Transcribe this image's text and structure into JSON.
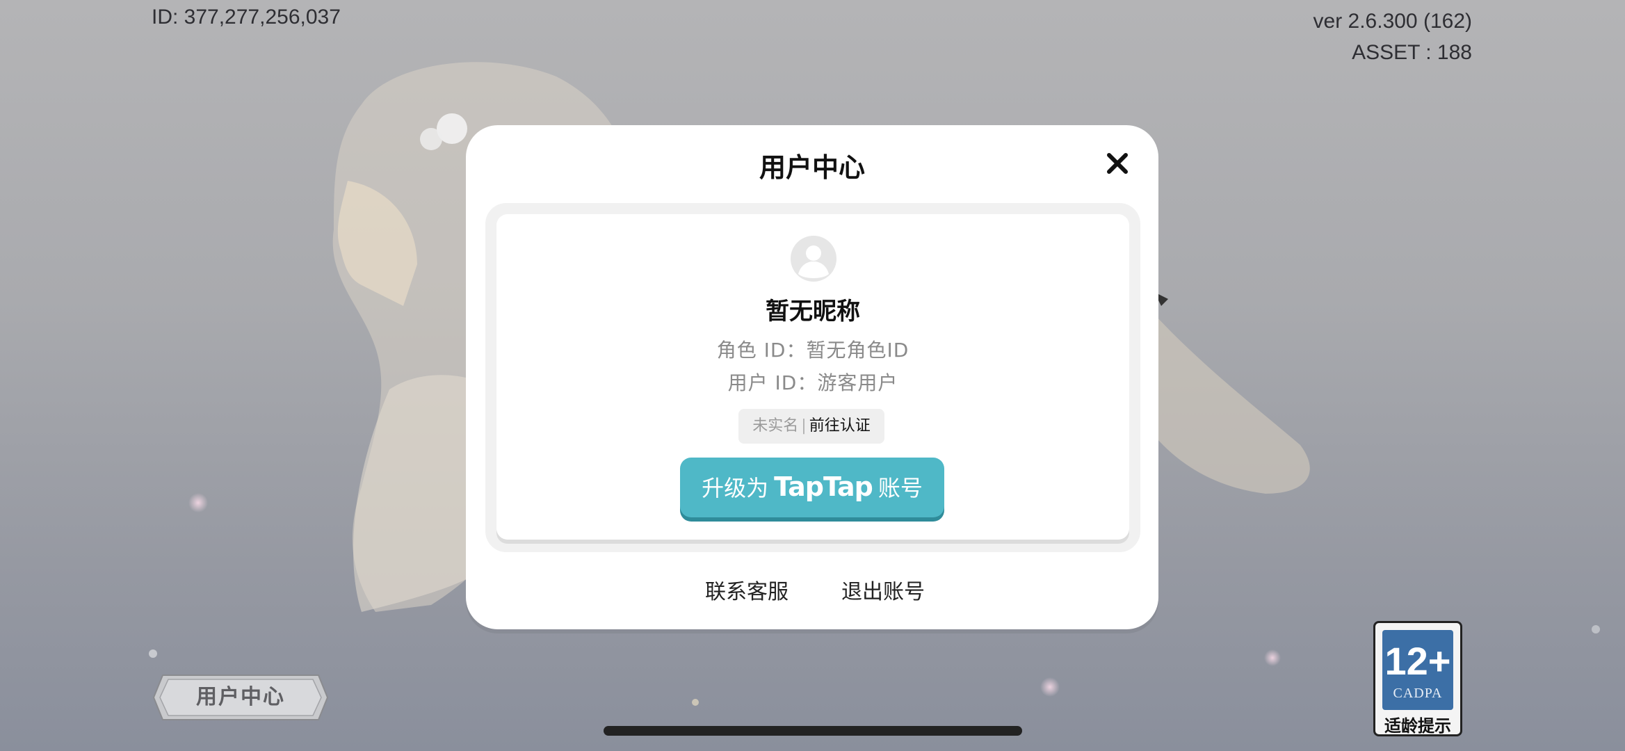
{
  "hud": {
    "player_id": "ID: 377,277,256,037",
    "version": "ver 2.6.300 (162)",
    "asset": "ASSET : 188"
  },
  "modal": {
    "title": "用户中心",
    "close_icon": "close-icon",
    "avatar_icon": "default-avatar-icon",
    "nickname": "暂无昵称",
    "role_id": "角色 ID：暂无角色ID",
    "user_id": "用户 ID：游客用户",
    "verify_status": "未实名",
    "verify_separator": "|",
    "verify_action": "前往认证",
    "upgrade_prefix": "升级为",
    "upgrade_brand": "TapTap",
    "upgrade_suffix": "账号",
    "contact_support": "联系客服",
    "logout": "退出账号"
  },
  "bottom": {
    "user_center_button": "用户中心"
  },
  "age_rating": {
    "age": "12+",
    "org": "CADPA",
    "tip": "适龄提示"
  },
  "colors": {
    "primary_button": "#4fb8c7",
    "rating_blue": "#3c6fa6"
  }
}
